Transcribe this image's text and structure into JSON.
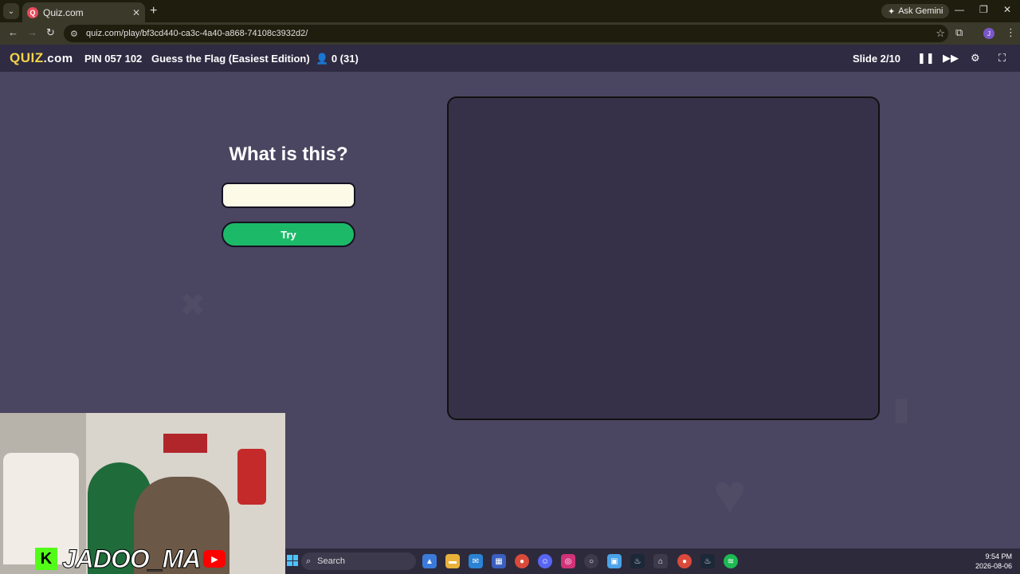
{
  "browser": {
    "tab_title": "Quiz.com",
    "favicon_letter": "Q",
    "tab_close": "✕",
    "new_tab": "+",
    "ask_gemini": "Ask Gemini",
    "url": "quiz.com/play/bf3cd440-ca3c-4a40-a868-74108c3932d2/",
    "profile_initial": "J"
  },
  "header": {
    "logo_main": "QUIZ",
    "logo_suffix": ".com",
    "pin": "PIN 057 102",
    "quiz_title": "Guess the Flag (Easiest Edition)",
    "players": "0 (31)",
    "slide": "Slide 2/10"
  },
  "play": {
    "question": "What is this?",
    "answer_value": "",
    "try_label": "Try"
  },
  "stream": {
    "kick_letter": "K",
    "channel_name": "JADOO_MA",
    "youtube_icon": "▶"
  },
  "taskbar": {
    "search_label": "Search",
    "time": "9:54 PM",
    "date": "2026-08-06"
  },
  "colors": {
    "accent_green": "#1cba68",
    "background": "#4a4560",
    "header": "#2f2b42",
    "panel": "#363148"
  },
  "icons": [
    "tab-list-icon",
    "back-icon",
    "forward-icon",
    "reload-icon",
    "site-info-icon",
    "bookmark-star-icon",
    "extensions-icon",
    "menu-icon",
    "player-icon",
    "pause-icon",
    "skip-icon",
    "settings-icon",
    "fullscreen-icon"
  ]
}
